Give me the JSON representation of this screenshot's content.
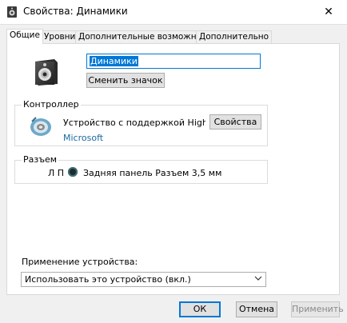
{
  "window": {
    "title": "Свойства: Динамики",
    "close_glyph": "✕"
  },
  "tabs": [
    {
      "label": "Общие",
      "active": true
    },
    {
      "label": "Уровни",
      "active": false
    },
    {
      "label": "Дополнительные возможности",
      "active": false
    },
    {
      "label": "Дополнительно",
      "active": false
    }
  ],
  "device": {
    "name_value": "Динамики",
    "change_icon_label": "Сменить значок",
    "icon": "speaker-icon"
  },
  "controller": {
    "group_label": "Контроллер",
    "name": "Устройство с поддержкой High Definition Audio",
    "vendor": "Microsoft",
    "properties_label": "Свойства",
    "icon": "sound-controller-icon"
  },
  "jack": {
    "group_label": "Разъем",
    "channels": "Л П",
    "description": "Задняя панель Разъем 3,5 мм"
  },
  "usage": {
    "label": "Применение устройства:",
    "selected": "Использовать это устройство (вкл.)"
  },
  "buttons": {
    "ok": "ОК",
    "cancel": "Отмена",
    "apply": "Применить"
  },
  "colors": {
    "accent": "#0078d7",
    "link": "#1a6ba0"
  }
}
